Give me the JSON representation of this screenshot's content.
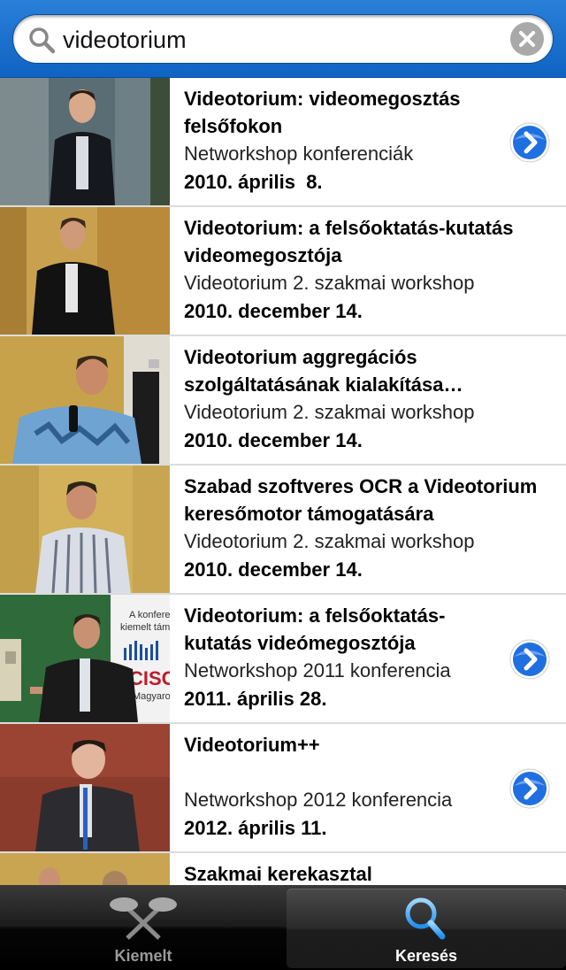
{
  "search": {
    "value": "videotorium"
  },
  "results": [
    {
      "title": "Videotorium: videomegosztás felsőfokon",
      "subtitle": "Networkshop konferenciák",
      "date": "2010. április  8.",
      "has_arrow": true
    },
    {
      "title": "Videotorium: a felsőoktatás-kutatás videomegosztója",
      "subtitle": "Videotorium 2. szakmai workshop",
      "date": "2010. december 14.",
      "has_arrow": false
    },
    {
      "title": "Videotorium aggregációs szolgáltatásának kialakítása szabványos",
      "subtitle": "Videotorium 2. szakmai workshop",
      "date": "2010. december 14.",
      "has_arrow": false
    },
    {
      "title": "Szabad szoftveres OCR a Videotorium keresőmotor támogatására",
      "subtitle": "Videotorium 2. szakmai workshop",
      "date": "2010. december 14.",
      "has_arrow": false
    },
    {
      "title": "Videotorium: a felsőoktatás-kutatás videómegosztója",
      "subtitle": "Networkshop 2011 konferencia",
      "date": "2011. április 28.",
      "has_arrow": true
    },
    {
      "title": "Videotorium++",
      "subtitle": "Networkshop 2012 konferencia",
      "date": "2012. április 11.",
      "has_arrow": true
    },
    {
      "title": "Szakmai kerekasztal",
      "subtitle": "",
      "date": "",
      "has_arrow": false
    }
  ],
  "thumb_text": {
    "row5_slide_line1": "A konferen",
    "row5_slide_line2": "kiemelt támog",
    "row5_logo": "CISCO",
    "row5_logo_sub": "Magyaro"
  },
  "tabs": [
    {
      "label": "Kiemelt",
      "icon": "film-reel-icon",
      "selected": false
    },
    {
      "label": "Keresés",
      "icon": "search-icon",
      "selected": true
    }
  ],
  "colors": {
    "header_blue": "#1a6fcf",
    "arrow_blue": "#1f6fe0",
    "tab_selected_text": "#ffffff",
    "tab_text": "#9a9a9a"
  }
}
